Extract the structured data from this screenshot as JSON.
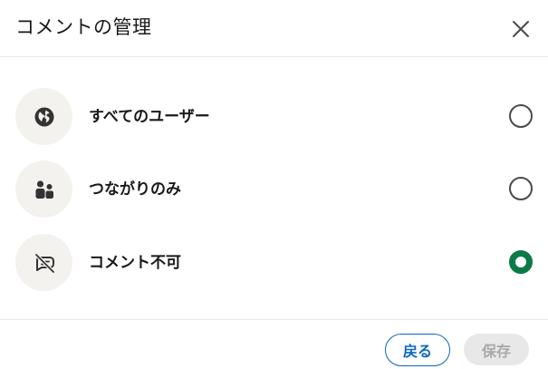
{
  "dialog": {
    "title": "コメントの管理",
    "close_icon": "close-icon"
  },
  "options": [
    {
      "label": "すべてのユーザー",
      "icon": "globe-icon",
      "selected": false
    },
    {
      "label": "つながりのみ",
      "icon": "people-icon",
      "selected": false
    },
    {
      "label": "コメント不可",
      "icon": "comment-off-icon",
      "selected": true
    }
  ],
  "footer": {
    "back_label": "戻る",
    "save_label": "保存"
  },
  "colors": {
    "accent_green": "#0b7a46",
    "link_blue": "#0a66c2",
    "icon_bg": "#f3f2ef",
    "disabled_bg": "#e8e8e8"
  }
}
